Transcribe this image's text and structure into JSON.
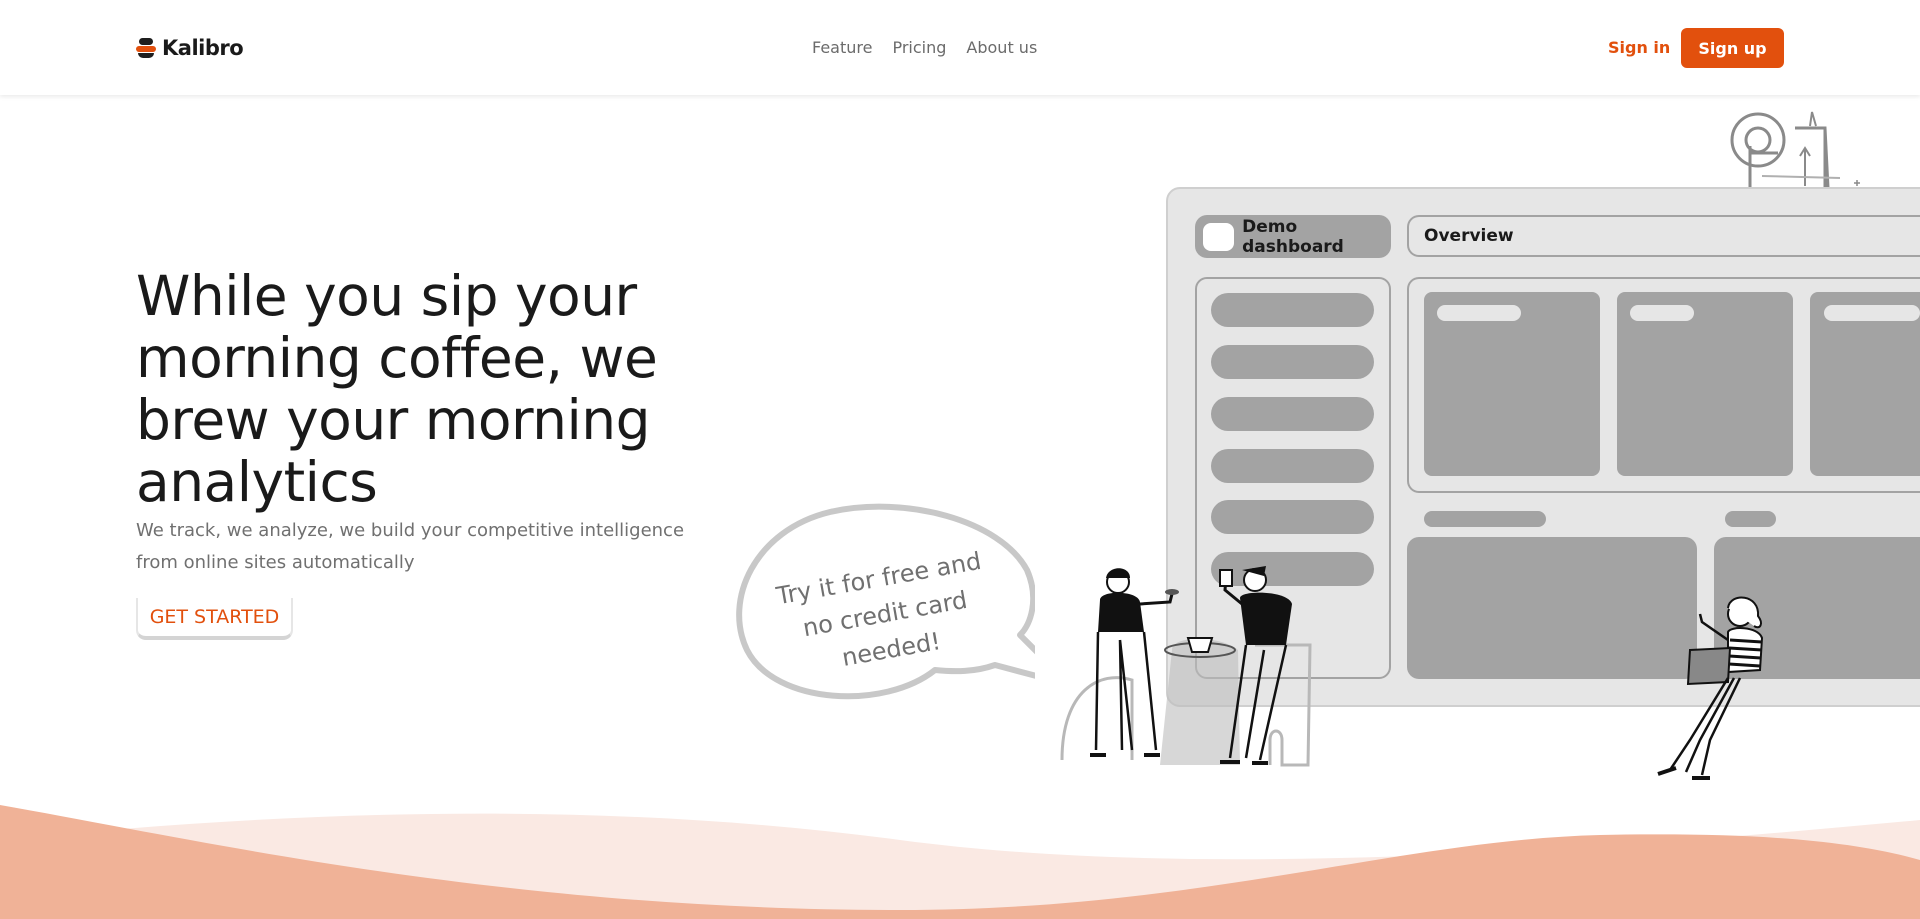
{
  "brand": {
    "name": "Kalibro",
    "accent": "#e2500d"
  },
  "nav": {
    "items": [
      "Feature",
      "Pricing",
      "About us"
    ]
  },
  "auth": {
    "signin_label": "Sign in",
    "signup_label": "Sign up"
  },
  "hero": {
    "title": "While you sip your morning coffee, we brew your morning analytics",
    "subtitle": "We track, we analyze, we build your competitive intelligence from online sites automatically",
    "cta_label": "GET STARTED"
  },
  "illustration": {
    "bubble_text": "Try it for free and no credit card needed!",
    "dashboard_tab": "Demo dashboard",
    "dashboard_view": "Overview"
  }
}
